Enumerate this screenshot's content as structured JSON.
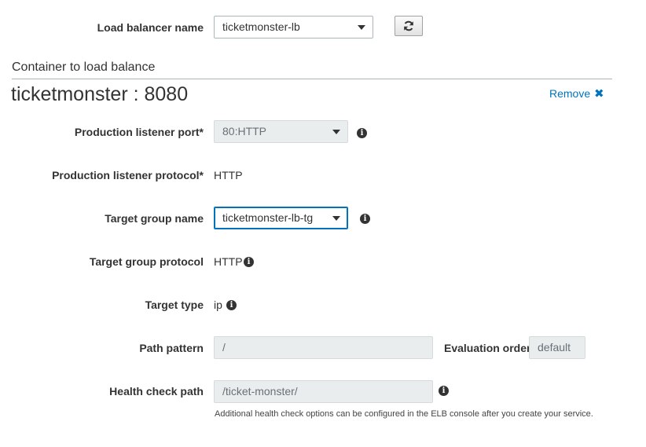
{
  "load_balancer": {
    "label": "Load balancer name",
    "value": "ticketmonster-lb"
  },
  "container": {
    "section_heading": "Container to load balance",
    "title": "ticketmonster : 8080",
    "remove_label": "Remove",
    "remove_icon": "✖"
  },
  "fields": {
    "production_listener_port": {
      "label": "Production listener port*",
      "value": "80:HTTP"
    },
    "production_listener_protocol": {
      "label": "Production listener protocol*",
      "value": "HTTP"
    },
    "target_group_name": {
      "label": "Target group name",
      "value": "ticketmonster-lb-tg"
    },
    "target_group_protocol": {
      "label": "Target group protocol",
      "value": "HTTP"
    },
    "target_type": {
      "label": "Target type",
      "value": "ip"
    },
    "path_pattern": {
      "label": "Path pattern",
      "value": "/"
    },
    "evaluation_order": {
      "label": "Evaluation order",
      "value": "default"
    },
    "health_check_path": {
      "label": "Health check path",
      "value": "/ticket-monster/",
      "hint": "Additional health check options can be configured in the ELB console after you create your service."
    }
  },
  "icons": {
    "info": "i",
    "refresh": "refresh-icon",
    "dropdown": "chevron-down-icon"
  },
  "colors": {
    "link": "#0073bb",
    "disabled_bg": "#eaeded",
    "border": "#aab7b8"
  }
}
